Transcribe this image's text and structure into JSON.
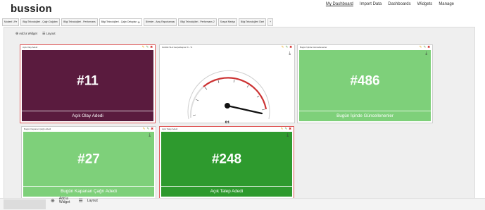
{
  "app": {
    "logo": "bussion"
  },
  "topnav": [
    "My Dashboard",
    "Import Data",
    "Dashboards",
    "Widgets",
    "Manage"
  ],
  "tabs": [
    {
      "label": "Modeel I-Pe"
    },
    {
      "label": "Bilgi Teknolojileri - Çağrı Dağılımı"
    },
    {
      "label": "Bilgi Teknolojileri - Performans"
    },
    {
      "label": "Bilgi Teknolojileri - Çağrı Detayları"
    },
    {
      "label": "Birimler - Araç Raporlaması"
    },
    {
      "label": "Bilgi Teknolojileri - Performans 2"
    },
    {
      "label": "Sosyal Medya"
    },
    {
      "label": "Bilgi Teknolojileri Özet"
    },
    {
      "label": "+"
    }
  ],
  "toolbar": {
    "add_widget": "Add a Widget",
    "layout": "Layout"
  },
  "widgets": [
    {
      "title": "Açık Olay Adedi",
      "value": "#11",
      "caption": "Açık Olay Adedi",
      "color": "#5a1b3e"
    },
    {
      "title": "Günlük SLA Gerçekleşme % - %",
      "gauge_value": "91",
      "gauge_percent": 91
    },
    {
      "title": "Bugün İçinde Güncellenenler",
      "value": "#486",
      "caption": "Bugün İçinde Güncellenenler",
      "color": "#7ed07a"
    },
    {
      "title": "Bugün Kapanan Çağrı Adedi",
      "value": "#27",
      "caption": "Bugün Kapanan Çağrı Adedi",
      "color": "#7ed07a"
    },
    {
      "title": "Açık Talep Adedi",
      "value": "#248",
      "caption": "Açık Talep Adedi",
      "color": "#2e9a2e"
    }
  ],
  "bottom": {
    "add_line1": "Add a",
    "add_line2": "Widget",
    "layout": "Layout"
  }
}
